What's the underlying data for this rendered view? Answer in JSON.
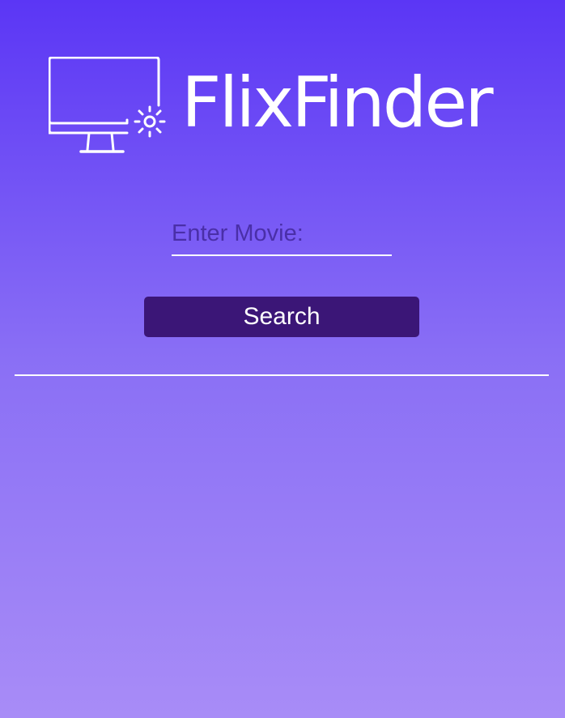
{
  "brand": {
    "name": "FlixFinder",
    "icon": "monitor-with-sparkle-icon"
  },
  "search": {
    "placeholder": "Enter Movie:",
    "value": "",
    "button_label": "Search"
  },
  "colors": {
    "background_top": "#5b36f5",
    "background_bottom": "#a88cf7",
    "button": "#3b1677",
    "text": "#ffffff"
  }
}
